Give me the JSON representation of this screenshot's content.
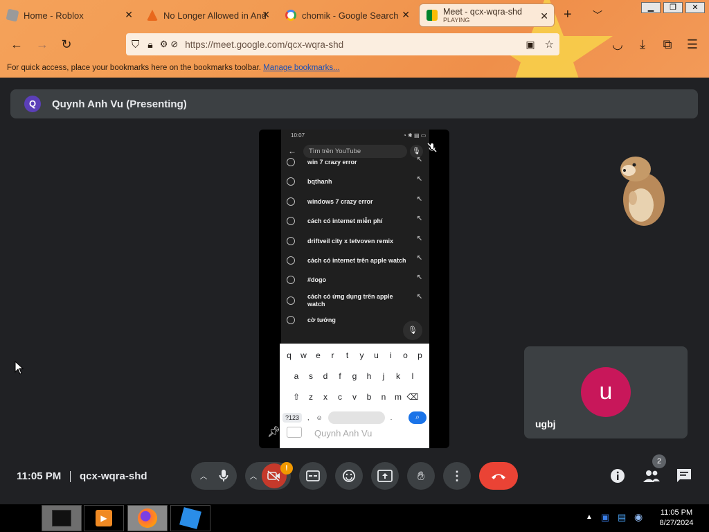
{
  "browser": {
    "tabs": [
      {
        "title": "Home - Roblox",
        "subtitle": ""
      },
      {
        "title": "No Longer Allowed in And",
        "subtitle": ""
      },
      {
        "title": "chomik - Google Search",
        "subtitle": ""
      },
      {
        "title": "Meet - qcx-wqra-shd",
        "subtitle": "PLAYING"
      }
    ],
    "new_tab_label": "+",
    "url": "https://meet.google.com/qcx-wqra-shd",
    "bookmarks_text": "For quick access, place your bookmarks here on the bookmarks toolbar.",
    "bookmarks_link": "Manage bookmarks..."
  },
  "meet": {
    "presenter_initial": "Q",
    "presenter_label": "Quynh Anh Vu (Presenting)",
    "participant_initial": "u",
    "participant_name": "ugbj",
    "clock": "11:05 PM",
    "meeting_code": "qcx-wqra-shd",
    "people_count": "2",
    "camera_alert": "!"
  },
  "phone": {
    "time": "10:07",
    "search_placeholder": "Tìm trên YouTube",
    "suggestions": [
      "win 7 crazy error",
      "bqthanh",
      "windows 7 crazy error",
      "cách có internet miễn phí",
      "driftveil city x tetvoven remix",
      "cách có internet trên apple watch",
      "#dogo",
      "cách có ứng dụng trên apple watch",
      "cờ tướng"
    ],
    "keyboard_row1": [
      "q",
      "w",
      "e",
      "r",
      "t",
      "y",
      "u",
      "i",
      "o",
      "p"
    ],
    "keyboard_row2": [
      "a",
      "s",
      "d",
      "f",
      "g",
      "h",
      "j",
      "k",
      "l"
    ],
    "keyboard_row3": [
      "z",
      "x",
      "c",
      "v",
      "b",
      "n",
      "m"
    ],
    "keyboard_sym": "?123",
    "keyboard_comma": ",",
    "keyboard_period": ".",
    "presenter_watermark": "Quynh Anh Vu"
  },
  "taskbar": {
    "time": "11:05 PM",
    "date": "8/27/2024"
  },
  "colors": {
    "meet_bg": "#202124",
    "end_call": "#ea4335",
    "participant_avatar": "#c8175a",
    "presenter_avatar": "#5b3fb8",
    "search_blue": "#1a73e8"
  }
}
